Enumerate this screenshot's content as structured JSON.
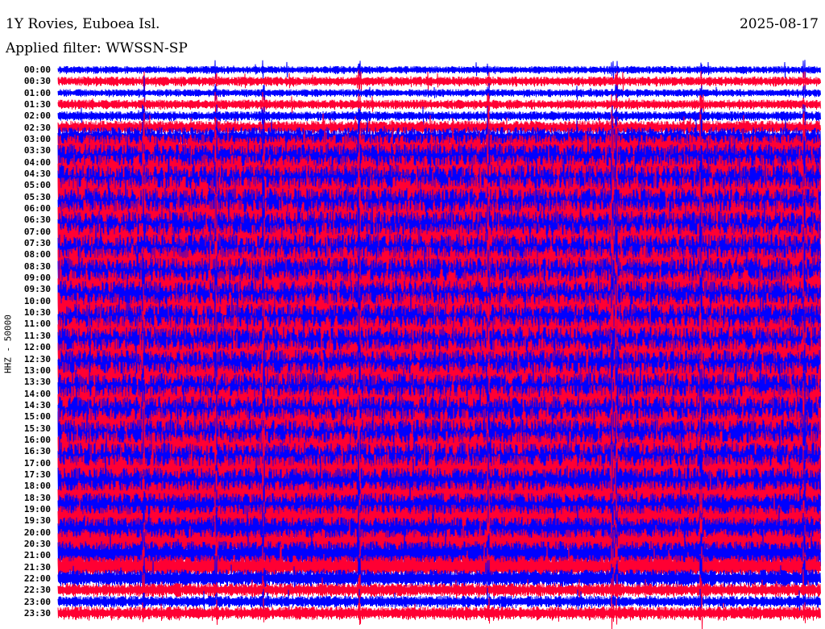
{
  "header": {
    "title": "1Y Rovies, Euboea Isl.",
    "filter": "Applied filter: WWSSN-SP",
    "date": "2025-08-17"
  },
  "chart_data": {
    "type": "line",
    "subtype": "helicorder",
    "ylabel": "HHZ - 50000",
    "row_labels": [
      "00:00",
      "00:30",
      "01:00",
      "01:30",
      "02:00",
      "02:30",
      "03:00",
      "03:30",
      "04:00",
      "04:30",
      "05:00",
      "05:30",
      "06:00",
      "06:30",
      "07:00",
      "07:30",
      "08:00",
      "08:30",
      "09:00",
      "09:30",
      "10:00",
      "10:30",
      "11:00",
      "11:30",
      "12:00",
      "12:30",
      "13:00",
      "13:30",
      "14:00",
      "14:30",
      "15:00",
      "15:30",
      "16:00",
      "16:30",
      "17:00",
      "17:30",
      "18:00",
      "18:30",
      "19:00",
      "19:30",
      "20:00",
      "20:30",
      "21:00",
      "21:30",
      "22:00",
      "22:30",
      "23:00",
      "23:30"
    ],
    "relative_amplitude": [
      0.2,
      0.25,
      0.2,
      0.25,
      0.25,
      0.35,
      0.6,
      0.8,
      0.9,
      0.95,
      1,
      1,
      1,
      1,
      1,
      1,
      1,
      1,
      1,
      1,
      1,
      1,
      1,
      1,
      1,
      1,
      1,
      1,
      1,
      1,
      1,
      1,
      1,
      1,
      1,
      1,
      0.9,
      0.85,
      0.8,
      0.8,
      0.75,
      0.75,
      0.7,
      0.6,
      0.45,
      0.35,
      0.3,
      0.35
    ],
    "series_colors": [
      "#0000ff",
      "#ff0033"
    ]
  }
}
